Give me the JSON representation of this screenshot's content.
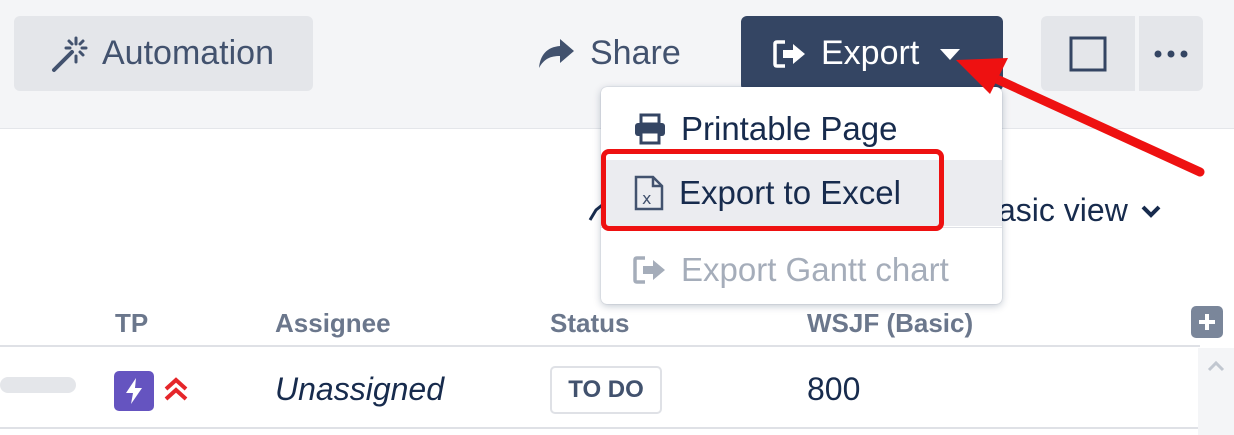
{
  "toolbar": {
    "automation_label": "Automation",
    "share_label": "Share",
    "export_label": "Export"
  },
  "export_menu": {
    "items": [
      {
        "label": "Printable Page",
        "icon": "printer-icon"
      },
      {
        "label": "Export to Excel",
        "icon": "excel-file-icon"
      },
      {
        "label": "Export Gantt chart",
        "icon": "export-icon"
      }
    ]
  },
  "view": {
    "partial_label": "asic view"
  },
  "table": {
    "headers": [
      "TP",
      "Assignee",
      "Status",
      "WSJF (Basic)"
    ],
    "rows": [
      {
        "assignee": "Unassigned",
        "status": "TO DO",
        "wsjf": "800"
      }
    ]
  },
  "colors": {
    "export_button_bg": "#344563",
    "highlight_red": "#ee1111",
    "tp_icon_purple": "#6554c0",
    "priority_red": "#e5262a"
  }
}
